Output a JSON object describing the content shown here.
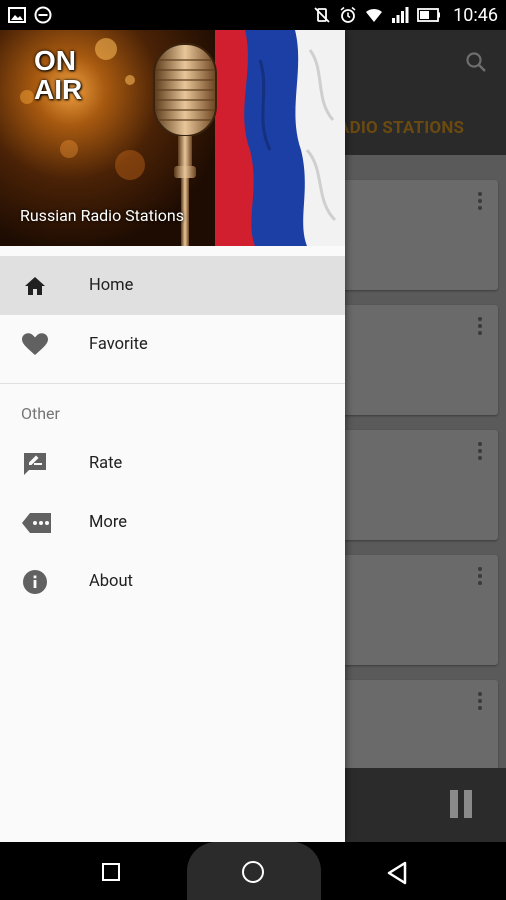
{
  "status_bar": {
    "time": "10:46"
  },
  "app": {
    "tab_label": "ADIO STATIONS",
    "card_count": 5
  },
  "drawer": {
    "header": {
      "badge_line1": "ON",
      "badge_line2": "AIR",
      "title": "Russian Radio Stations"
    },
    "main_items": [
      {
        "label": "Home",
        "icon": "home-icon",
        "active": true
      },
      {
        "label": "Favorite",
        "icon": "heart-icon",
        "active": false
      }
    ],
    "section_title": "Other",
    "other_items": [
      {
        "label": "Rate",
        "icon": "rate-review-icon"
      },
      {
        "label": "More",
        "icon": "more-tag-icon"
      },
      {
        "label": "About",
        "icon": "info-icon"
      }
    ]
  },
  "colors": {
    "drawer_bg": "#fafafa",
    "active_item_bg": "#e0e0e0",
    "icon_color": "#616161",
    "tab_accent": "#6b4a10"
  }
}
